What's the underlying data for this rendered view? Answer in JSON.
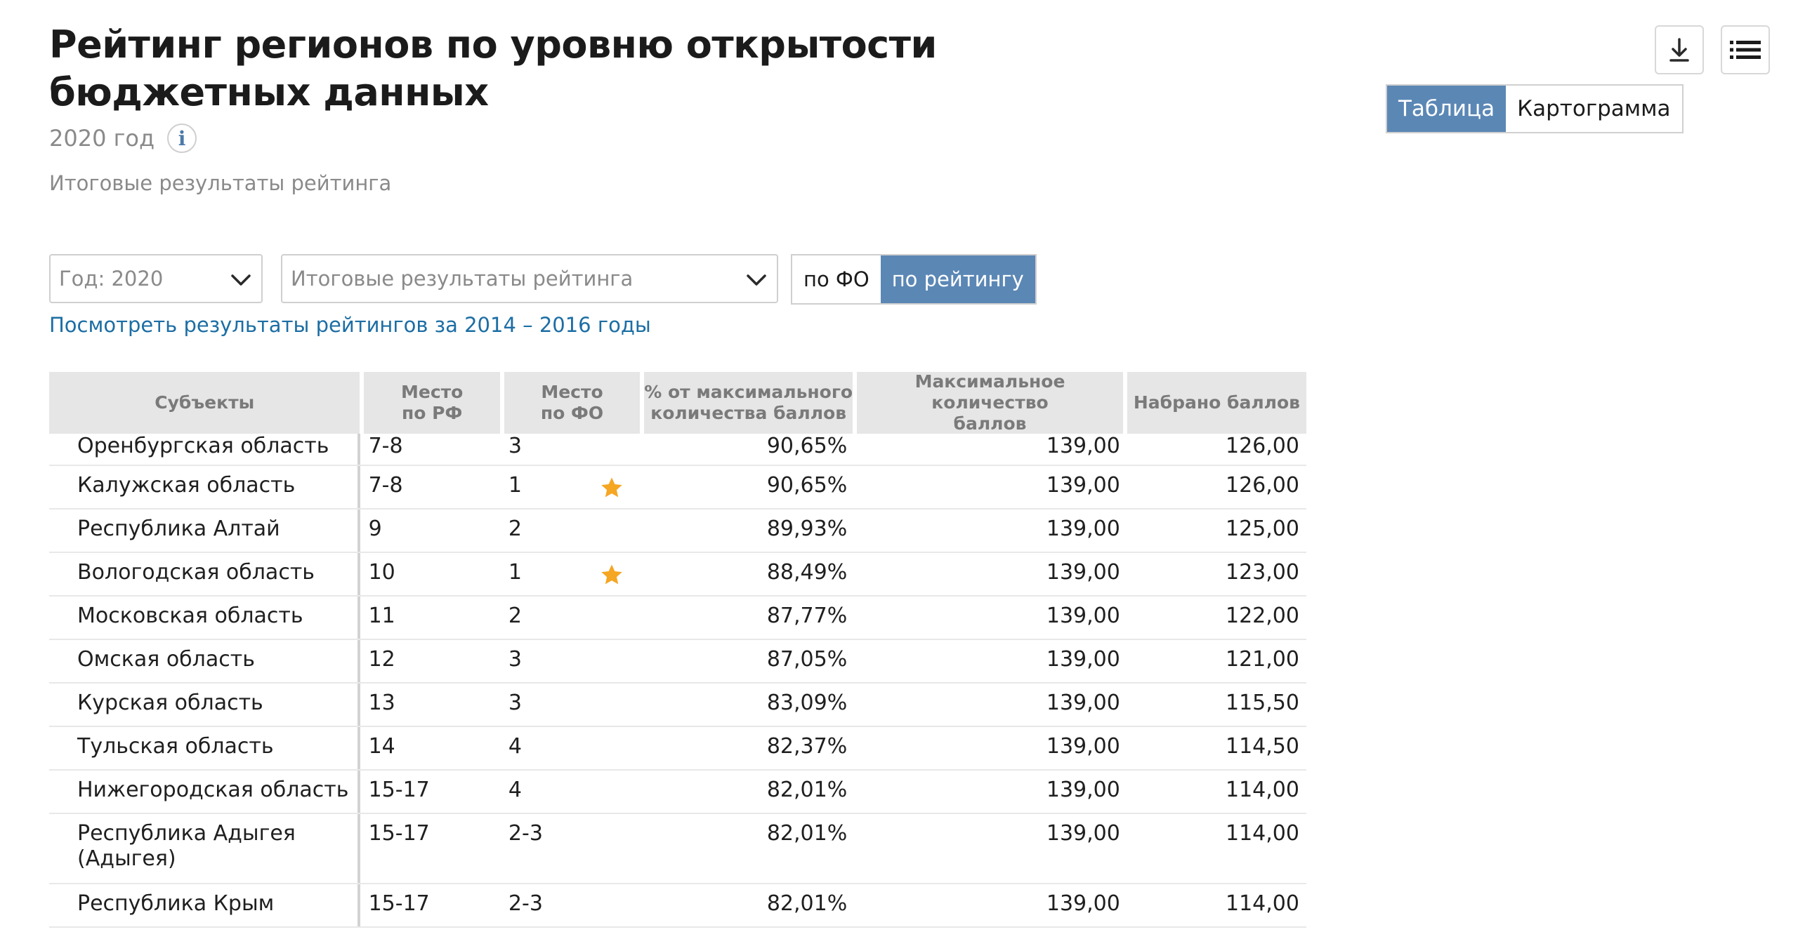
{
  "page": {
    "title_line1": "Рейтинг регионов по уровню открытости",
    "title_line2": "бюджетных данных",
    "year_label": "2020 год",
    "info_glyph": "i",
    "subtitle": "Итоговые результаты рейтинга"
  },
  "toolbar": {
    "download_icon": "download-icon",
    "list_icon": "list-icon"
  },
  "view_switch": {
    "table": "Таблица",
    "map": "Картограмма",
    "active": "table"
  },
  "filters": {
    "year_select": "Год: 2020",
    "rating_select": "Итоговые результаты рейтинга",
    "group_by_fo": "по ФО",
    "group_by_rating": "по рейтингу",
    "active_group": "по рейтингу"
  },
  "link_text": "Посмотреть результаты рейтингов за 2014 – 2016 годы",
  "colors": {
    "accent": "#5b87b5",
    "link": "#1c6ea4",
    "star": "#f5a623",
    "header_bg": "#e6e6e6"
  },
  "table": {
    "headers": {
      "subject": "Субъекты",
      "rank_rf_1": "Место",
      "rank_rf_2": "по РФ",
      "rank_fo_1": "Место",
      "rank_fo_2": "по ФО",
      "pct_1": "% от максимального",
      "pct_2": "количества баллов",
      "max_1": "Максимальное количество",
      "max_2": "баллов",
      "got": "Набрано баллов"
    },
    "rows": [
      {
        "subject": "Оренбургская область",
        "rf": "7-8",
        "fo": "3",
        "star": false,
        "pct": "90,65%",
        "max": "139,00",
        "got": "126,00"
      },
      {
        "subject": "Калужская область",
        "rf": "7-8",
        "fo": "1",
        "star": true,
        "pct": "90,65%",
        "max": "139,00",
        "got": "126,00"
      },
      {
        "subject": "Республика Алтай",
        "rf": "9",
        "fo": "2",
        "star": false,
        "pct": "89,93%",
        "max": "139,00",
        "got": "125,00"
      },
      {
        "subject": "Вологодская область",
        "rf": "10",
        "fo": "1",
        "star": true,
        "pct": "88,49%",
        "max": "139,00",
        "got": "123,00"
      },
      {
        "subject": "Московская область",
        "rf": "11",
        "fo": "2",
        "star": false,
        "pct": "87,77%",
        "max": "139,00",
        "got": "122,00"
      },
      {
        "subject": "Омская область",
        "rf": "12",
        "fo": "3",
        "star": false,
        "pct": "87,05%",
        "max": "139,00",
        "got": "121,00"
      },
      {
        "subject": "Курская область",
        "rf": "13",
        "fo": "3",
        "star": false,
        "pct": "83,09%",
        "max": "139,00",
        "got": "115,50"
      },
      {
        "subject": "Тульская область",
        "rf": "14",
        "fo": "4",
        "star": false,
        "pct": "82,37%",
        "max": "139,00",
        "got": "114,50"
      },
      {
        "subject": "Нижегородская область",
        "rf": "15-17",
        "fo": "4",
        "star": false,
        "pct": "82,01%",
        "max": "139,00",
        "got": "114,00"
      },
      {
        "subject": "Республика Адыгея (Адыгея)",
        "rf": "15-17",
        "fo": "2-3",
        "star": false,
        "pct": "82,01%",
        "max": "139,00",
        "got": "114,00"
      },
      {
        "subject": "Республика Крым",
        "rf": "15-17",
        "fo": "2-3",
        "star": false,
        "pct": "82,01%",
        "max": "139,00",
        "got": "114,00"
      }
    ]
  }
}
